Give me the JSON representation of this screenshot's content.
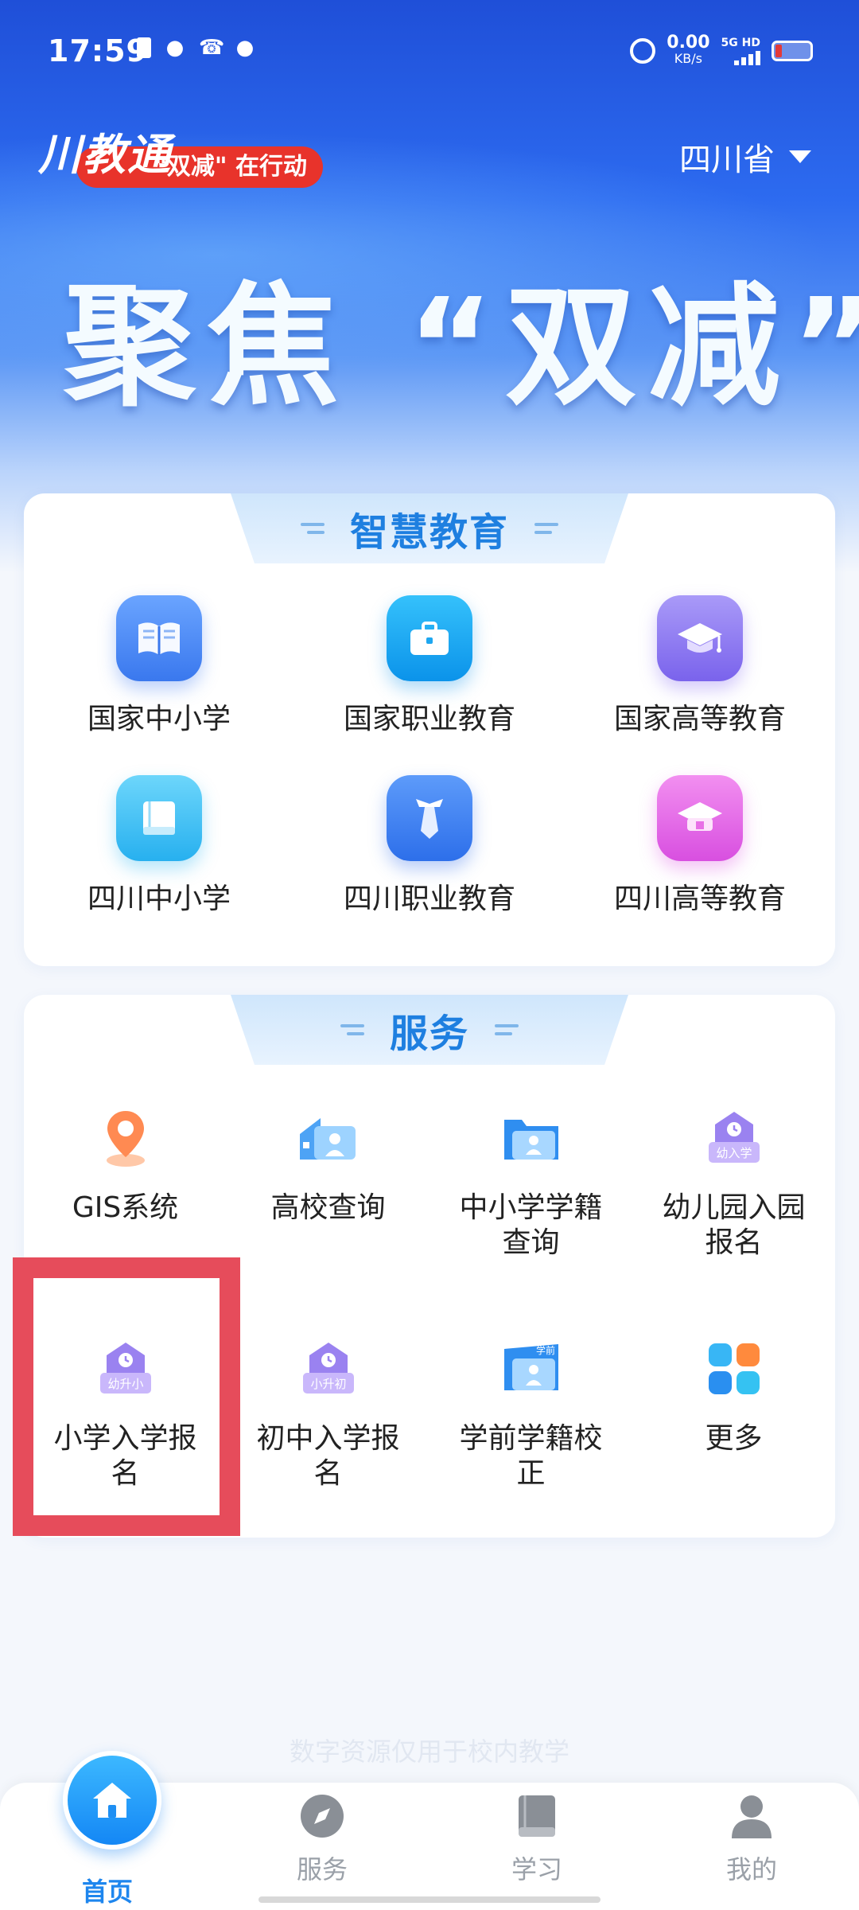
{
  "status_bar": {
    "time": "17:59",
    "net_speed_value": "0.00",
    "net_speed_unit": "KB/s",
    "network_tag": "5G HD"
  },
  "header": {
    "logo_script": "川教通",
    "logo_slogan": "\"双减\" 在行动",
    "province": "四川省",
    "banner_text": "聚焦 “双减”"
  },
  "smart_edu": {
    "title": "智慧教育",
    "items": [
      {
        "label": "国家中小学",
        "icon": "book-open-icon",
        "color": "#4a8af4"
      },
      {
        "label": "国家职业教育",
        "icon": "briefcase-icon",
        "color": "#1ea7f0"
      },
      {
        "label": "国家高等教育",
        "icon": "graduation-cap-icon",
        "color": "#8f7cf2"
      },
      {
        "label": "四川中小学",
        "icon": "book-icon",
        "color": "#41c2f2"
      },
      {
        "label": "四川职业教育",
        "icon": "tie-icon",
        "color": "#3f8bf4"
      },
      {
        "label": "四川高等教育",
        "icon": "grad-cap-icon",
        "color": "#e86ee3"
      }
    ]
  },
  "services": {
    "title": "服务",
    "items": [
      {
        "label": "GIS系统",
        "icon": "location-pin-icon"
      },
      {
        "label": "高校查询",
        "icon": "school-building-icon"
      },
      {
        "label": "中小学学籍查询",
        "icon": "folder-person-icon"
      },
      {
        "label": "幼儿园入园报名",
        "icon": "house-clock-icon",
        "badge": "幼入学"
      },
      {
        "label": "小学入学报名",
        "icon": "house-clock-icon",
        "badge": "幼升小"
      },
      {
        "label": "初中入学报名",
        "icon": "house-clock-icon",
        "badge": "小升初"
      },
      {
        "label": "学前学籍校正",
        "icon": "folder-person-icon",
        "badge": "学前"
      },
      {
        "label": "更多",
        "icon": "grid-icon"
      }
    ]
  },
  "footer_note": "数字资源仅用于校内教学",
  "tabbar": {
    "items": [
      {
        "label": "首页",
        "icon": "home-icon",
        "active": true
      },
      {
        "label": "服务",
        "icon": "compass-icon"
      },
      {
        "label": "学习",
        "icon": "book-icon"
      },
      {
        "label": "我的",
        "icon": "person-icon"
      }
    ],
    "active_color": "#1e86ee"
  }
}
